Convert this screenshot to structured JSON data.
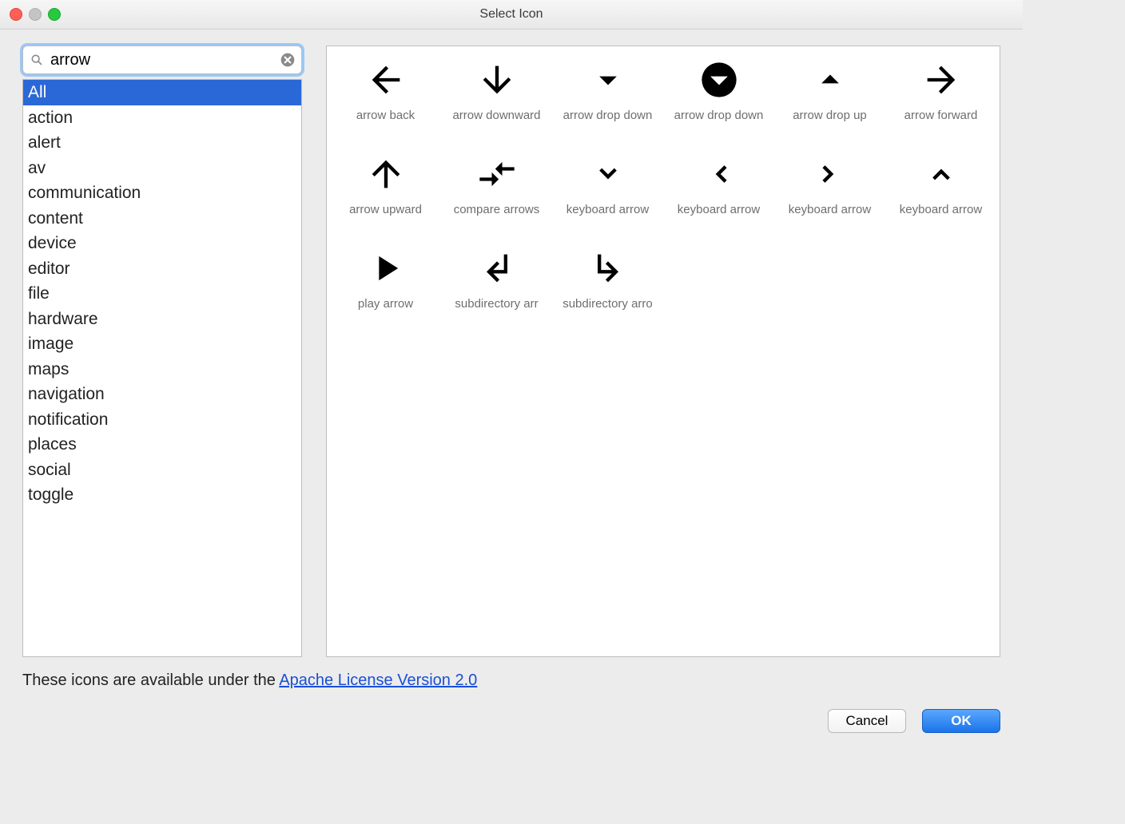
{
  "window": {
    "title": "Select Icon"
  },
  "search": {
    "value": "arrow"
  },
  "categories": {
    "selected_index": 0,
    "items": [
      "All",
      "action",
      "alert",
      "av",
      "communication",
      "content",
      "device",
      "editor",
      "file",
      "hardware",
      "image",
      "maps",
      "navigation",
      "notification",
      "places",
      "social",
      "toggle"
    ]
  },
  "icons": [
    {
      "id": "arrow-back",
      "label": "arrow back"
    },
    {
      "id": "arrow-downward",
      "label": "arrow downward"
    },
    {
      "id": "arrow-drop-down",
      "label": "arrow drop down"
    },
    {
      "id": "arrow-drop-down-circle",
      "label": "arrow drop down"
    },
    {
      "id": "arrow-drop-up",
      "label": "arrow drop up"
    },
    {
      "id": "arrow-forward",
      "label": "arrow forward"
    },
    {
      "id": "arrow-upward",
      "label": "arrow upward"
    },
    {
      "id": "compare-arrows",
      "label": "compare arrows"
    },
    {
      "id": "keyboard-arrow-down",
      "label": "keyboard arrow "
    },
    {
      "id": "keyboard-arrow-left",
      "label": "keyboard arrow "
    },
    {
      "id": "keyboard-arrow-right",
      "label": "keyboard arrow "
    },
    {
      "id": "keyboard-arrow-up",
      "label": "keyboard arrow "
    },
    {
      "id": "play-arrow",
      "label": "play arrow"
    },
    {
      "id": "subdirectory-arrow-left",
      "label": "subdirectory arr"
    },
    {
      "id": "subdirectory-arrow-right",
      "label": "subdirectory arro"
    }
  ],
  "license": {
    "prefix": "These icons are available under the ",
    "link_text": "Apache License Version 2.0"
  },
  "buttons": {
    "cancel": "Cancel",
    "ok": "OK"
  }
}
